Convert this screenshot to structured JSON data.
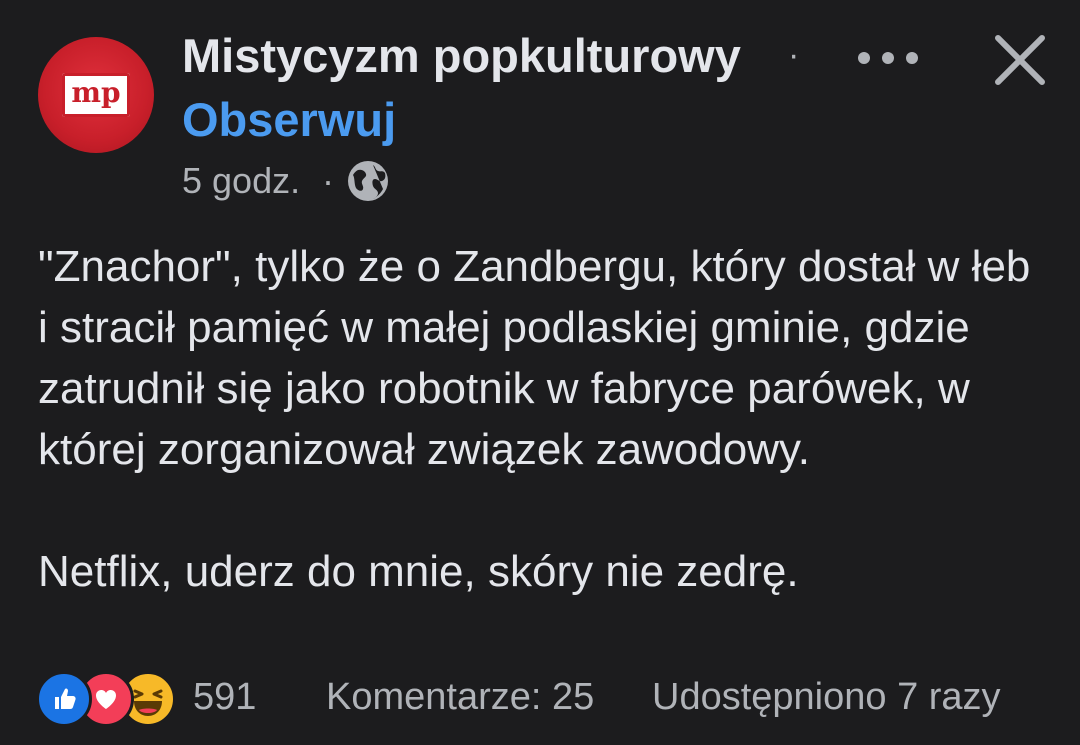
{
  "header": {
    "page_name": "Mistycyzm popkulturowy",
    "separator": "·",
    "follow_label": "Obserwuj",
    "avatar_text": "mp"
  },
  "meta": {
    "time": "5 godz.",
    "separator": "·",
    "audience_icon": "globe-icon"
  },
  "post": {
    "paragraphs": [
      "\"Znachor\", tylko że o Zandbergu, który dostał w łeb i stracił pamięć w małej podlaskiej gminie, gdzie zatrudnił się jako robotnik w fabryce parówek, w której zorganizował związek zawodowy.",
      "Netflix, uderz do mnie, skóry nie zedrę."
    ]
  },
  "footer": {
    "reactions": [
      "like-icon",
      "love-icon",
      "haha-icon"
    ],
    "reaction_count": "591",
    "comments": "Komentarze: 25",
    "shares": "Udostępniono 7 razy"
  },
  "colors": {
    "background": "#1c1c1e",
    "primary_text": "#e4e6eb",
    "secondary_text": "#b0b3b8",
    "link": "#4b9bf0",
    "avatar_red": "#c81f2a",
    "like_blue": "#1b74e4",
    "love_red": "#f33e58",
    "haha_yellow": "#f7b928"
  }
}
